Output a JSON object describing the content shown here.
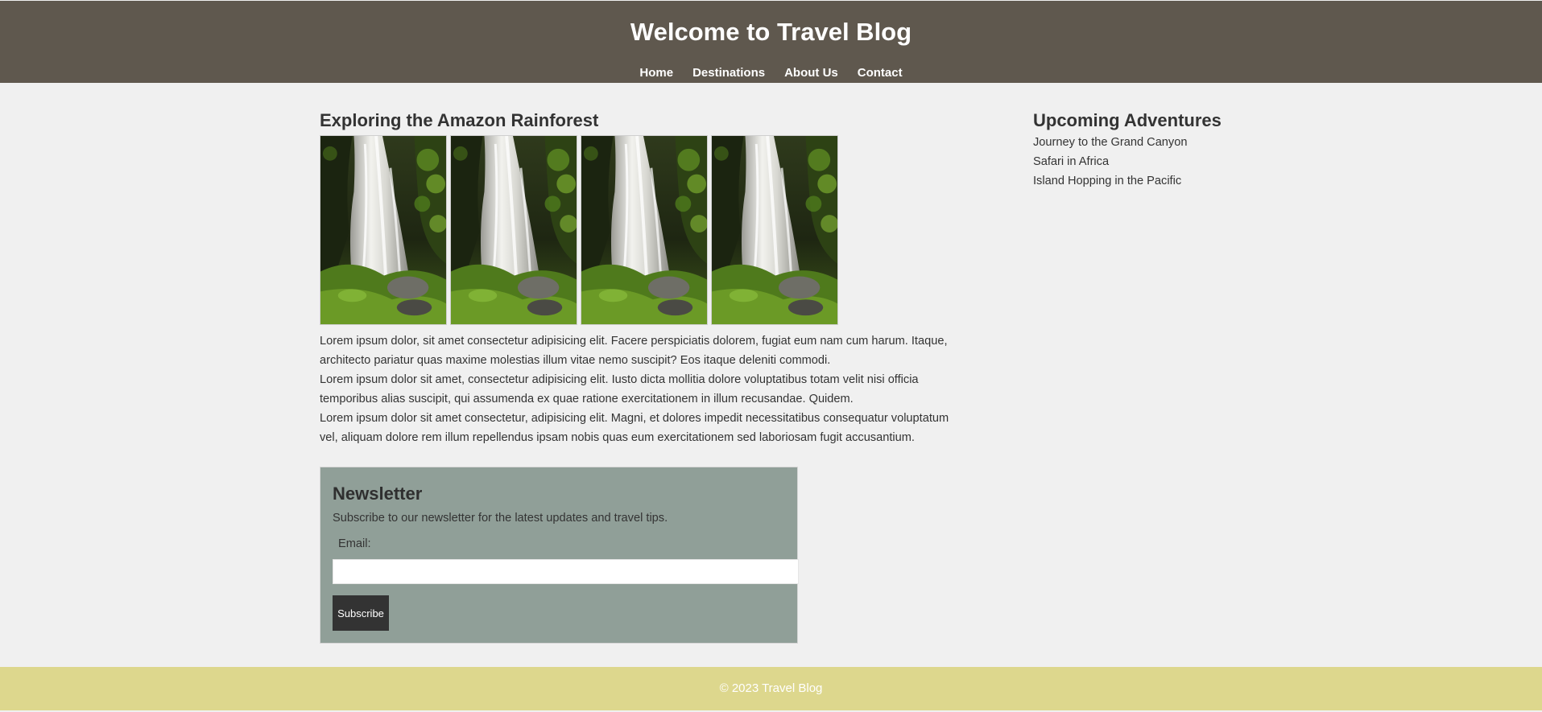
{
  "header": {
    "title": "Welcome to Travel Blog",
    "nav": [
      {
        "label": "Home"
      },
      {
        "label": "Destinations"
      },
      {
        "label": "About Us"
      },
      {
        "label": "Contact"
      }
    ]
  },
  "article": {
    "title": "Exploring the Amazon Rainforest",
    "images": [
      {
        "subject": "waterfall"
      },
      {
        "subject": "waterfall"
      },
      {
        "subject": "waterfall"
      },
      {
        "subject": "waterfall"
      }
    ],
    "paragraphs": [
      "Lorem ipsum dolor, sit amet consectetur adipisicing elit. Facere perspiciatis dolorem, fugiat eum nam cum harum. Itaque, architecto pariatur quas maxime molestias illum vitae nemo suscipit? Eos itaque deleniti commodi.",
      "Lorem ipsum dolor sit amet, consectetur adipisicing elit. Iusto dicta mollitia dolore voluptatibus totam velit nisi officia temporibus alias suscipit, qui assumenda ex quae ratione exercitationem in illum recusandae. Quidem.",
      "Lorem ipsum dolor sit amet consectetur, adipisicing elit. Magni, et dolores impedit necessitatibus consequatur voluptatum vel, aliquam dolore rem illum repellendus ipsam nobis quas eum exercitationem sed laboriosam fugit accusantium."
    ]
  },
  "newsletter": {
    "title": "Newsletter",
    "description": "Subscribe to our newsletter for the latest updates and travel tips.",
    "email_label": "Email:",
    "email_value": "",
    "email_placeholder": "",
    "button_label": "Subscribe"
  },
  "sidebar": {
    "title": "Upcoming Adventures",
    "items": [
      {
        "label": "Journey to the Grand Canyon"
      },
      {
        "label": "Safari in Africa"
      },
      {
        "label": "Island Hopping in the Pacific"
      }
    ]
  },
  "footer": {
    "text": "© 2023 Travel Blog"
  },
  "colors": {
    "header_bg": "#5f584e",
    "newsletter_bg": "#909f98",
    "footer_bg": "#ddd78d",
    "button_bg": "#333333",
    "page_bg": "#f0f0f0"
  }
}
